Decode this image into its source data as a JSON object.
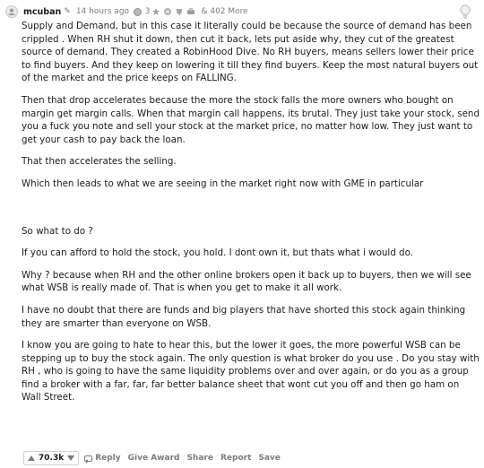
{
  "header": {
    "username": "mcuban",
    "edited_glyph": "✎",
    "timestamp": "14 hours ago",
    "award_count": "3",
    "more_awards": "& 402 More"
  },
  "body": {
    "paragraphs": [
      "Supply and Demand, but in this case it literally could be because the source of demand has been crippled . When RH shut it down, then cut it back, lets put aside why, they cut of the greatest source of demand. They created a RobinHood Dive. No RH buyers, means sellers lower their price to find buyers. And they keep on lowering it till they find buyers. Keep the most natural buyers out of the market and the price keeps on FALLING.",
      "Then that drop accelerates because the more the stock falls the more owners who bought on margin get margin calls. When that margin call happens, its brutal. They just take your stock, send you a fuck you note and sell your stock at the market price, no matter how low. They just want to get your cash to pay back the loan.",
      "That then accelerates the selling.",
      "Which then leads to what we are seeing in the market right now with GME in particular",
      "So what to do ?",
      "If you can afford to hold the stock, you hold. I dont own it, but thats what i would do.",
      "Why ? because when RH and the other online brokers open it back up to buyers, then we will see what WSB is really made of. That is when you get to make it all work.",
      "I have no doubt that there are funds and big players that have shorted this stock again thinking they are smarter than everyone on WSB.",
      "I know you are going to hate to hear this, but the lower it goes, the more powerful WSB can be stepping up to buy the stock again. The only question is what broker do you use . Do you stay with RH , who is going to have the same liquidity problems over and over again, or do you as a group find a broker with a far, far, far better balance sheet that wont cut you off and then go ham on Wall Street."
    ]
  },
  "footer": {
    "score": "70.3k",
    "reply": "Reply",
    "give_award": "Give Award",
    "share": "Share",
    "report": "Report",
    "save": "Save"
  },
  "icons": {
    "avatar": "avatar-icon",
    "award": "award-icon",
    "upvote": "upvote-arrow-icon",
    "downvote": "downvote-arrow-icon",
    "reply": "reply-icon",
    "lightbulb": "lightbulb-icon"
  }
}
